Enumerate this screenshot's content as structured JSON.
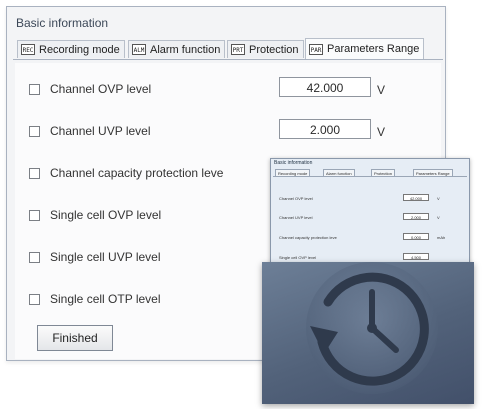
{
  "dialog": {
    "title": "Basic information",
    "tabs": [
      {
        "icon_text": "REC",
        "label": "Recording mode"
      },
      {
        "icon_text": "ALM",
        "label": "Alarm function"
      },
      {
        "icon_text": "PRT",
        "label": "Protection"
      },
      {
        "icon_text": "PAR",
        "label": "Parameters Range"
      }
    ],
    "rows": [
      {
        "label": "Channel OVP level",
        "value": "42.000",
        "unit": "V"
      },
      {
        "label": "Channel UVP level",
        "value": "2.000",
        "unit": "V"
      },
      {
        "label": "Channel capacity protection leve"
      },
      {
        "label": "Single cell OVP level"
      },
      {
        "label": "Single cell UVP level"
      },
      {
        "label": "Single cell OTP level"
      }
    ],
    "finish_label": "Finished"
  },
  "thumbnail": {
    "title": "Basic information",
    "tabs": [
      "Recording mode",
      "Alarm function",
      "Protection",
      "Parameters Range"
    ],
    "rows": [
      {
        "label": "Channel OVP level",
        "value": "42.000",
        "unit": "V"
      },
      {
        "label": "Channel UVP level",
        "value": "2.000",
        "unit": "V"
      },
      {
        "label": "Channel capacity protection leve",
        "value": "0.000",
        "unit": "mAh"
      },
      {
        "label": "Single cell OVP level",
        "value": "4.500",
        "unit": ""
      }
    ]
  },
  "history_card": {
    "icon": "history-clock-icon"
  },
  "colors": {
    "border": "#a9b2c0",
    "card": "#52627a"
  }
}
